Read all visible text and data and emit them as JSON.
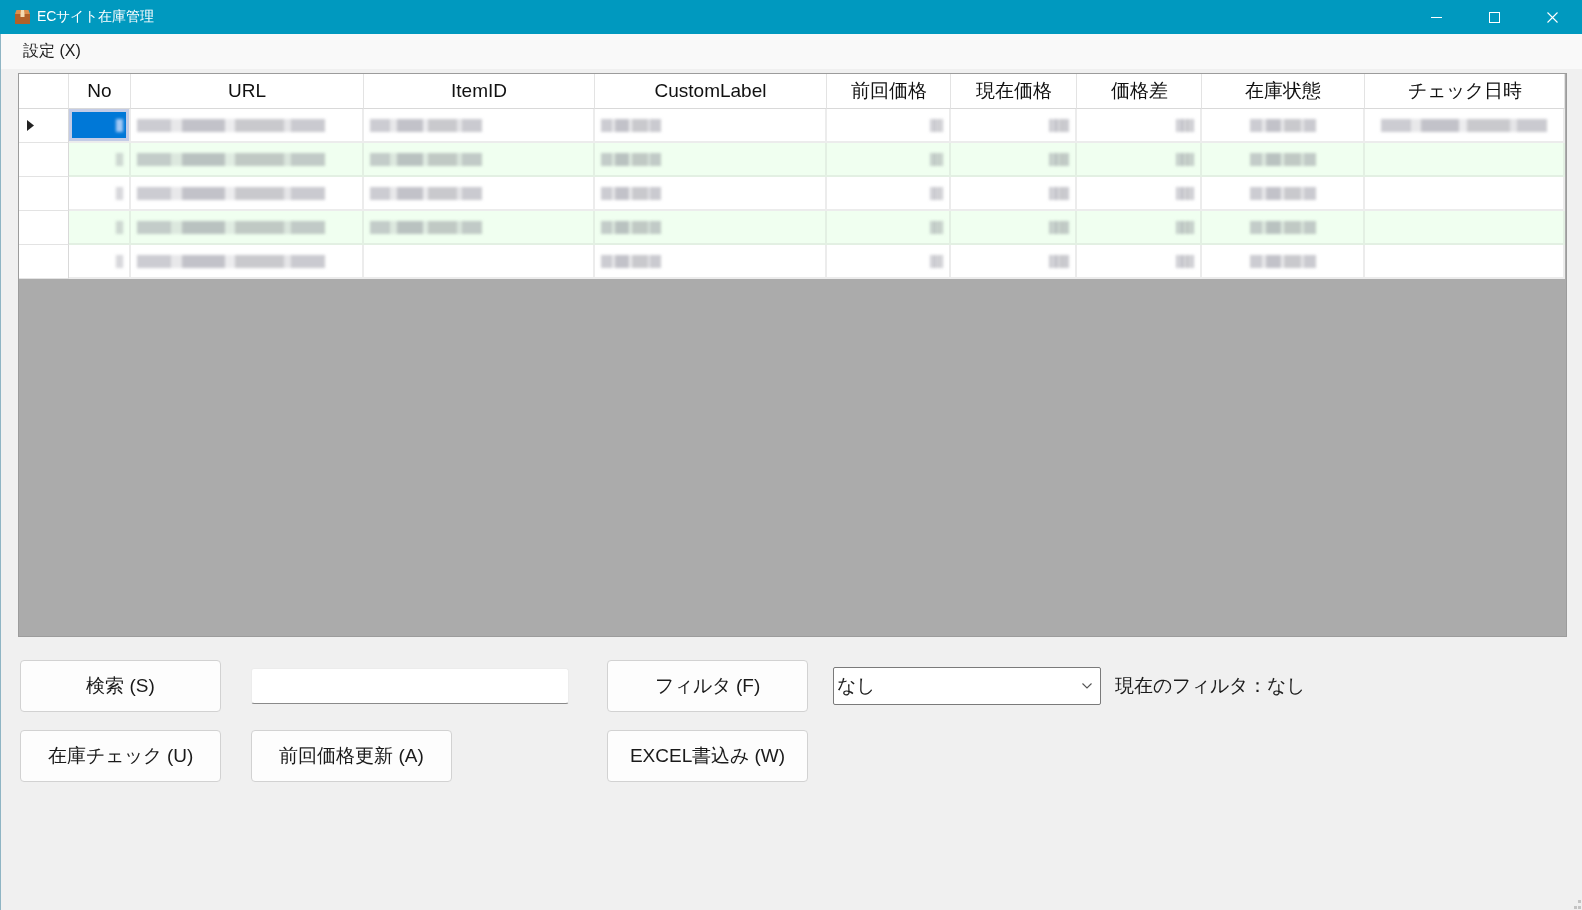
{
  "window": {
    "title": "ECサイト在庫管理"
  },
  "menu": [
    {
      "label": "設定 (X)"
    }
  ],
  "grid": {
    "columns": [
      "No",
      "URL",
      "ItemID",
      "CustomLabel",
      "前回価格",
      "現在価格",
      "価格差",
      "在庫状態",
      "チェック日時"
    ],
    "rows": [
      {
        "current": true,
        "cells": [
          {
            "kind": "blurred",
            "selected": true
          },
          {
            "kind": "blurred",
            "selected": false
          },
          {
            "kind": "blurred",
            "selected": false
          },
          {
            "kind": "blurred",
            "selected": false
          },
          {
            "kind": "blurred",
            "selected": false
          },
          {
            "kind": "blurred",
            "selected": false
          },
          {
            "kind": "blurred",
            "selected": false
          },
          {
            "kind": "blurred",
            "selected": false
          },
          {
            "kind": "blurred",
            "selected": false
          }
        ]
      },
      {
        "current": false,
        "cells": [
          {
            "kind": "blurred",
            "selected": false
          },
          {
            "kind": "blurred",
            "selected": false
          },
          {
            "kind": "blurred",
            "selected": false
          },
          {
            "kind": "blurred",
            "selected": false
          },
          {
            "kind": "blurred",
            "selected": false
          },
          {
            "kind": "blurred",
            "selected": false
          },
          {
            "kind": "blurred",
            "selected": false
          },
          {
            "kind": "blurred",
            "selected": false
          },
          {
            "kind": "empty",
            "selected": false
          }
        ]
      },
      {
        "current": false,
        "cells": [
          {
            "kind": "blurred",
            "selected": false
          },
          {
            "kind": "blurred",
            "selected": false
          },
          {
            "kind": "blurred",
            "selected": false
          },
          {
            "kind": "blurred",
            "selected": false
          },
          {
            "kind": "blurred",
            "selected": false
          },
          {
            "kind": "blurred",
            "selected": false
          },
          {
            "kind": "blurred",
            "selected": false
          },
          {
            "kind": "blurred",
            "selected": false
          },
          {
            "kind": "empty",
            "selected": false
          }
        ]
      },
      {
        "current": false,
        "cells": [
          {
            "kind": "blurred",
            "selected": false
          },
          {
            "kind": "blurred",
            "selected": false
          },
          {
            "kind": "blurred",
            "selected": false
          },
          {
            "kind": "blurred",
            "selected": false
          },
          {
            "kind": "blurred",
            "selected": false
          },
          {
            "kind": "blurred",
            "selected": false
          },
          {
            "kind": "blurred",
            "selected": false
          },
          {
            "kind": "blurred",
            "selected": false
          },
          {
            "kind": "empty",
            "selected": false
          }
        ]
      },
      {
        "current": false,
        "cells": [
          {
            "kind": "blurred",
            "selected": false
          },
          {
            "kind": "blurred",
            "selected": false
          },
          {
            "kind": "empty",
            "selected": false
          },
          {
            "kind": "blurred",
            "selected": false
          },
          {
            "kind": "blurred",
            "selected": false
          },
          {
            "kind": "blurred",
            "selected": false
          },
          {
            "kind": "blurred",
            "selected": false
          },
          {
            "kind": "blurred",
            "selected": false
          },
          {
            "kind": "empty",
            "selected": false
          }
        ]
      }
    ]
  },
  "controls": {
    "search_button": "検索 (S)",
    "filter_button": "フィルタ (F)",
    "filter_select": {
      "value": "なし"
    },
    "filter_status": "現在のフィルタ：なし",
    "check_stock_button": "在庫チェック (U)",
    "update_price_button": "前回価格更新 (A)",
    "excel_button": "EXCEL書込み (W)"
  }
}
